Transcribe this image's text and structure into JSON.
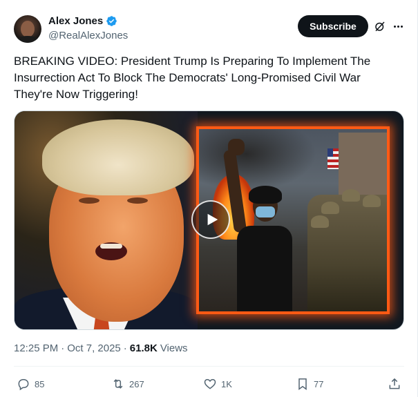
{
  "author": {
    "display_name": "Alex Jones",
    "handle": "@RealAlexJones",
    "verified": true
  },
  "header": {
    "subscribe_label": "Subscribe",
    "icons": [
      "grok-icon",
      "more-icon"
    ]
  },
  "tweet": {
    "text": "BREAKING VIDEO: President Trump Is Preparing To Implement The Insurrection Act To Block The Democrats' Long-Promised Civil War They're Now Triggering!",
    "media_type": "video"
  },
  "meta": {
    "time": "12:25 PM",
    "separator": "·",
    "date": "Oct 7, 2025",
    "views_count": "61.8K",
    "views_label": "Views"
  },
  "actions": {
    "replies": "85",
    "reposts": "267",
    "likes": "1K",
    "bookmarks": "77"
  },
  "colors": {
    "text_primary": "#0f1419",
    "text_secondary": "#536471",
    "verified_blue": "#1d9bf0",
    "frame_accent": "#ff5a14"
  }
}
